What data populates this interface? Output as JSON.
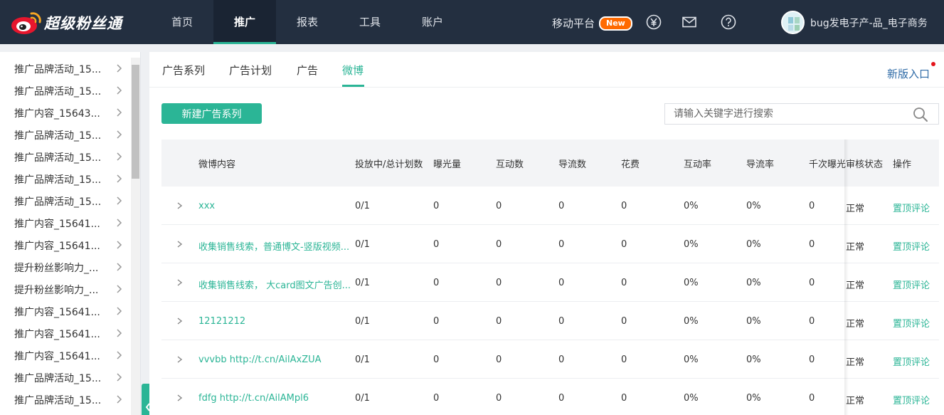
{
  "brand": {
    "name": "超级粉丝通"
  },
  "nav": {
    "items": [
      "首页",
      "推广",
      "报表",
      "工具",
      "账户"
    ],
    "active_index": 1
  },
  "header": {
    "mobile_label": "移动平台",
    "mobile_badge": "New",
    "icons": [
      "yen-icon",
      "mail-icon",
      "help-icon"
    ],
    "user_name": "bug发电子产-品_电子商务"
  },
  "sidebar": {
    "items": [
      "推广品牌活动_15...",
      "推广品牌活动_15...",
      "推广内容_15643...",
      "推广品牌活动_15...",
      "推广品牌活动_15...",
      "推广品牌活动_15...",
      "推广品牌活动_15...",
      "推广内容_15641...",
      "推广内容_15641...",
      "提升粉丝影响力_...",
      "提升粉丝影响力_...",
      "推广内容_15641...",
      "推广内容_15641...",
      "推广内容_15641...",
      "推广品牌活动_15...",
      "推广品牌活动_15..."
    ]
  },
  "tabs": {
    "items": [
      "广告系列",
      "广告计划",
      "广告",
      "微博"
    ],
    "active_index": 3,
    "new_entry": "新版入口"
  },
  "toolbar": {
    "new_button": "新建广告系列",
    "search_placeholder": "请输入关键字进行搜索"
  },
  "table": {
    "headers": [
      "微博内容",
      "投放中/总计划数",
      "曝光量",
      "互动数",
      "导流数",
      "花费",
      "互动率",
      "导流率",
      "千次曝光",
      "审核状态",
      "操作"
    ],
    "rows": [
      {
        "content": "xxx",
        "plans": "0/1",
        "exposure": "0",
        "interactions": "0",
        "traffic": "0",
        "cost": "0",
        "interaction_rate": "0%",
        "traffic_rate": "0%",
        "cpm": "0",
        "status": "正常",
        "action": "置顶评论"
      },
      {
        "content": "收集销售线索，普通博文-竖版视频...",
        "plans": "0/1",
        "exposure": "0",
        "interactions": "0",
        "traffic": "0",
        "cost": "0",
        "interaction_rate": "0%",
        "traffic_rate": "0%",
        "cpm": "0",
        "status": "正常",
        "action": "置顶评论"
      },
      {
        "content": "收集销售线索， 大card图文广告创...",
        "plans": "0/1",
        "exposure": "0",
        "interactions": "0",
        "traffic": "0",
        "cost": "0",
        "interaction_rate": "0%",
        "traffic_rate": "0%",
        "cpm": "0",
        "status": "正常",
        "action": "置顶评论"
      },
      {
        "content": "12121212",
        "plans": "0/1",
        "exposure": "0",
        "interactions": "0",
        "traffic": "0",
        "cost": "0",
        "interaction_rate": "0%",
        "traffic_rate": "0%",
        "cpm": "0",
        "status": "正常",
        "action": "置顶评论"
      },
      {
        "content": "vvvbb http://t.cn/AilAxZUA",
        "plans": "0/1",
        "exposure": "0",
        "interactions": "0",
        "traffic": "0",
        "cost": "0",
        "interaction_rate": "0%",
        "traffic_rate": "0%",
        "cpm": "0",
        "status": "正常",
        "action": "置顶评论"
      },
      {
        "content": "fdfg http://t.cn/AilAMpl6",
        "plans": "0/1",
        "exposure": "0",
        "interactions": "0",
        "traffic": "0",
        "cost": "0",
        "interaction_rate": "0%",
        "traffic_rate": "0%",
        "cpm": "0",
        "status": "正常",
        "action": "置顶评论"
      }
    ]
  },
  "colors": {
    "accent": "#2bb596",
    "topbar": "#232f40",
    "badge": "#ff6a00",
    "link_blue": "#2d6aa6"
  }
}
